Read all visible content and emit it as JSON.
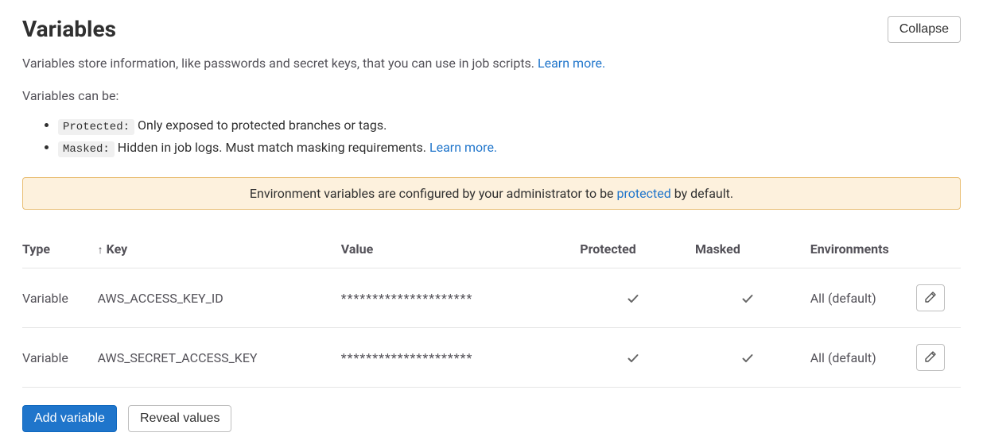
{
  "header": {
    "title": "Variables",
    "collapse_label": "Collapse"
  },
  "description": {
    "intro_text": "Variables store information, like passwords and secret keys, that you can use in job scripts. ",
    "intro_link": "Learn more.",
    "sub_text": "Variables can be:",
    "bullets": [
      {
        "pill": "Protected:",
        "text": " Only exposed to protected branches or tags.",
        "link": ""
      },
      {
        "pill": "Masked:",
        "text": " Hidden in job logs. Must match masking requirements. ",
        "link": "Learn more."
      }
    ]
  },
  "banner": {
    "text_before": "Environment variables are configured by your administrator to be ",
    "link_text": "protected",
    "text_after": " by default."
  },
  "table": {
    "columns": {
      "type": "Type",
      "key": "Key",
      "value": "Value",
      "protected": "Protected",
      "masked": "Masked",
      "environments": "Environments"
    },
    "rows": [
      {
        "type": "Variable",
        "key": "AWS_ACCESS_KEY_ID",
        "value": "*********************",
        "protected": true,
        "masked": true,
        "environments": "All (default)"
      },
      {
        "type": "Variable",
        "key": "AWS_SECRET_ACCESS_KEY",
        "value": "*********************",
        "protected": true,
        "masked": true,
        "environments": "All (default)"
      }
    ]
  },
  "actions": {
    "add_variable": "Add variable",
    "reveal_values": "Reveal values"
  }
}
